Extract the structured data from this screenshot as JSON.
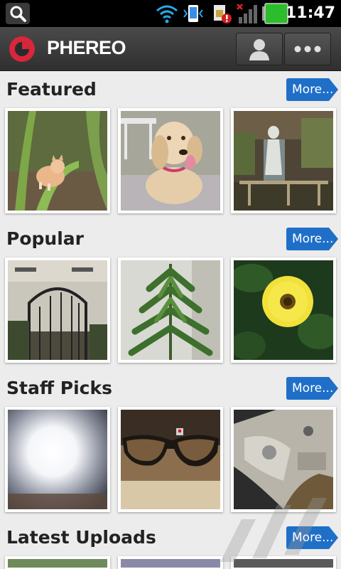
{
  "status_bar": {
    "time": "11:47",
    "icons": [
      "search-icon",
      "wifi-icon",
      "sync-icon",
      "sim-alert-icon",
      "signal-icon",
      "battery-icon"
    ]
  },
  "action_bar": {
    "title": "PHEREO",
    "brand_color": "#d8263a",
    "buttons": [
      "profile-icon",
      "overflow-menu-icon"
    ]
  },
  "sections": [
    {
      "title": "Featured",
      "more_label": "More...",
      "thumbnails": [
        "kitten-in-grass",
        "puppy-dog",
        "garden-statue-fountain"
      ]
    },
    {
      "title": "Popular",
      "more_label": "More...",
      "thumbnails": [
        "iron-gate-building",
        "green-plant",
        "yellow-flower"
      ]
    },
    {
      "title": "Staff Picks",
      "more_label": "More...",
      "thumbnails": [
        "bright-light-tunnel",
        "sunglasses",
        "bike-brake-caliper"
      ]
    },
    {
      "title": "Latest Uploads",
      "more_label": "More...",
      "thumbnails": []
    }
  ],
  "accent_color": "#1f6fc8"
}
